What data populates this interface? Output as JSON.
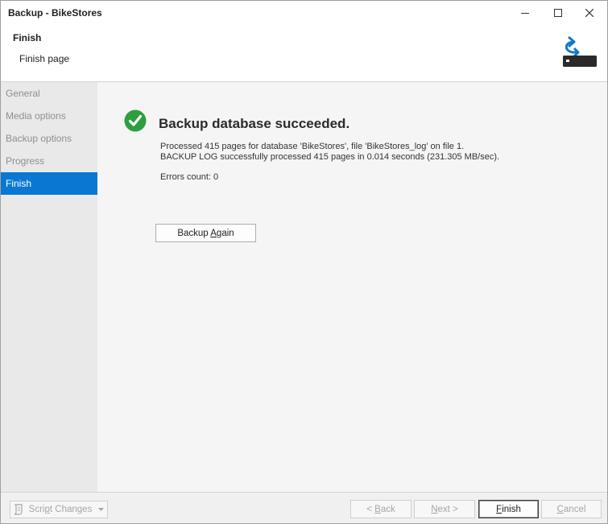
{
  "window": {
    "title": "Backup - BikeStores",
    "controls": {
      "minimize_icon": "minimize-icon",
      "maximize_icon": "maximize-icon",
      "close_icon": "close-icon"
    }
  },
  "header": {
    "title": "Finish",
    "subtitle": "Finish page",
    "icon": "backup-drive-icon"
  },
  "sidebar": {
    "items": [
      {
        "label": "General",
        "active": false
      },
      {
        "label": "Media options",
        "active": false
      },
      {
        "label": "Backup options",
        "active": false
      },
      {
        "label": "Progress",
        "active": false
      },
      {
        "label": "Finish",
        "active": true
      }
    ]
  },
  "result": {
    "icon": "success-check-icon",
    "title": "Backup database succeeded.",
    "lines": [
      "Processed 415 pages for database 'BikeStores', file 'BikeStores_log' on file 1.",
      "BACKUP LOG successfully processed 415 pages in 0.014 seconds (231.305 MB/sec)."
    ],
    "errors": "Errors count: 0",
    "backup_again": {
      "before": "Backup ",
      "mnemonic": "A",
      "after": "gain"
    }
  },
  "footer": {
    "script_changes": {
      "before": "Scri",
      "mnemonic": "p",
      "after": "t Changes"
    },
    "back": {
      "before": "< ",
      "mnemonic": "B",
      "after": "ack"
    },
    "next": {
      "before": "",
      "mnemonic": "N",
      "after": "ext >"
    },
    "finish": {
      "before": "",
      "mnemonic": "F",
      "after": "inish"
    },
    "cancel": {
      "before": "",
      "mnemonic": "C",
      "after": "ancel"
    }
  },
  "colors": {
    "accent": "#0a78d2",
    "success": "#2e9e3e"
  }
}
